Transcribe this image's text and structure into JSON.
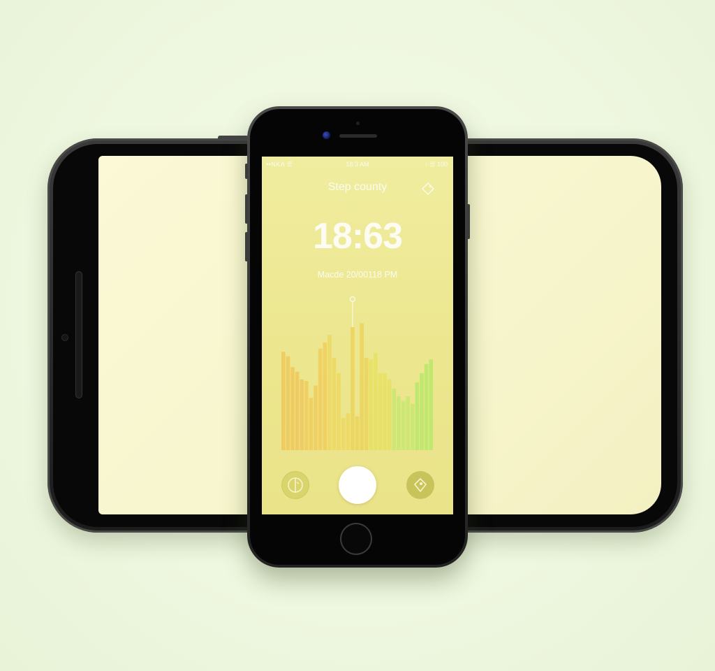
{
  "status_bar": {
    "carrier": "••NKA ☰",
    "time": "18:3 AM",
    "battery": "↑ ☰ 100"
  },
  "app": {
    "title": "Step county",
    "clock": "18:63",
    "subtitle": "Macde 20/00118 PM"
  },
  "chart_data": {
    "type": "bar",
    "series": [
      {
        "values": [
          128,
          122,
          108,
          102,
          92,
          90,
          68,
          84,
          132,
          140,
          150,
          120,
          100,
          42,
          48,
          160,
          44,
          165,
          120,
          118,
          126,
          100,
          100,
          92,
          80,
          70,
          64,
          70,
          60,
          88,
          100,
          112,
          118
        ]
      }
    ],
    "colors": [
      "#f0c85a",
      "#f1cd5c",
      "#eed860",
      "#ecd45a",
      "#e8e060",
      "#c8e870",
      "#b8e86a"
    ],
    "ylim": [
      0,
      200
    ],
    "highlight_index": 15,
    "grid": false
  },
  "controls": {
    "left_icon": "split-circle-icon",
    "center_icon": "start-button",
    "right_icon": "tag-icon"
  },
  "theme": {
    "background": "#eff8e0",
    "screen": "#ece68e",
    "device": "#1c1c1c"
  }
}
